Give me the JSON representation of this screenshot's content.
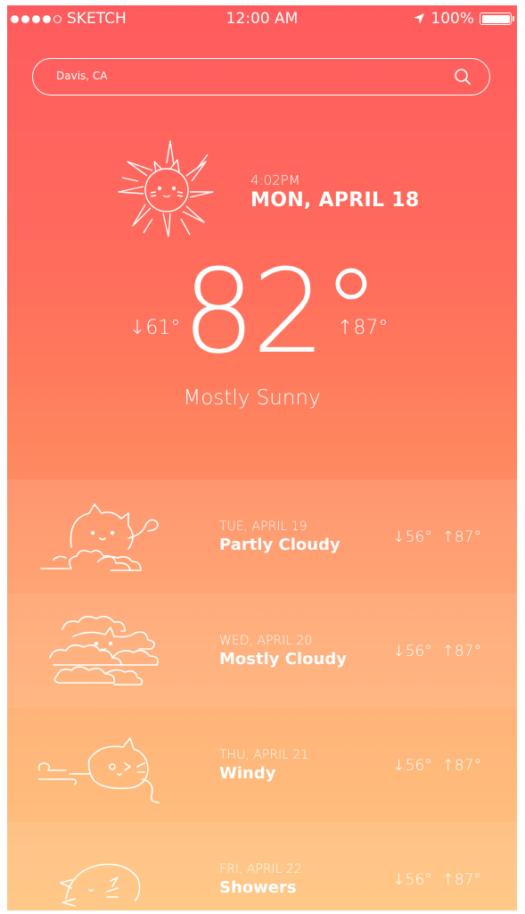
{
  "status_bar": {
    "carrier": "SKETCH",
    "time": "12:00 AM",
    "battery": "100%",
    "signal_bars": 4,
    "signal_total": 5
  },
  "search": {
    "location": "Davis, CA",
    "icon": "search-icon"
  },
  "current": {
    "time": "4:02PM",
    "date": "MON, APRIL 18",
    "low": "↓61°",
    "temp": "82°",
    "high": "↑87°",
    "condition": "Mostly Sunny",
    "icon": "sun-cat-icon"
  },
  "forecast": [
    {
      "date": "TUE, APRIL 19",
      "condition": "Partly Cloudy",
      "low": "↓56°",
      "high": "↑87°",
      "icon": "partly-cloudy-cat-icon"
    },
    {
      "date": "WED, APRIL 20",
      "condition": "Mostly Cloudy",
      "low": "↓56°",
      "high": "↑87°",
      "icon": "mostly-cloudy-cat-icon"
    },
    {
      "date": "THU, APRIL 21",
      "condition": "Windy",
      "low": "↓56°",
      "high": "↑87°",
      "icon": "windy-cat-icon"
    },
    {
      "date": "FRI, APRIL 22",
      "condition": "Showers",
      "low": "↓56°",
      "high": "↑87°",
      "icon": "showers-cat-icon"
    }
  ],
  "colors": {
    "top": "#ff5b5e",
    "bottom": "#ffbf72",
    "text": "#ffffff"
  }
}
